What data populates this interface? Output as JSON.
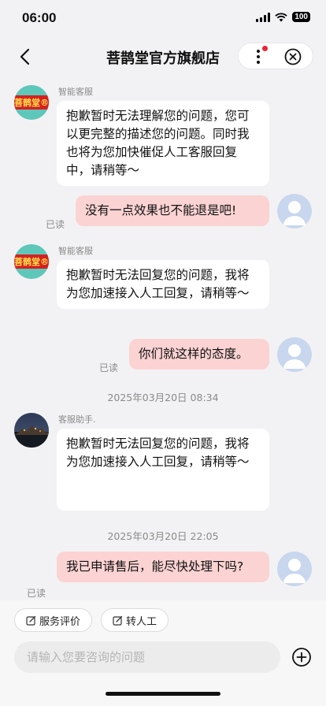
{
  "status_bar": {
    "time": "06:00",
    "battery": "100"
  },
  "nav": {
    "title": "菩鹊堂官方旗舰店"
  },
  "store": {
    "logo_text": "菩鹊堂®"
  },
  "messages": [
    {
      "sender": "智能客服",
      "text": "抱歉暂时无法理解您的问题，您可以更完整的描述您的问题。同时我也将为您加快催促人工客服回复中，请稍等～"
    },
    {
      "text": "没有一点效果也不能退是吧!",
      "read": "已读"
    },
    {
      "sender": "智能客服",
      "text": "抱歉暂时无法回复您的问题，我将为您加速接入人工回复，请稍等～"
    },
    {
      "text": "你们就这样的态度。",
      "read": "已读"
    },
    {
      "timestamp": "2025年03月20日 08:34"
    },
    {
      "sender": "客服助手.",
      "text": "抱歉暂时无法回复您的问题，我将为您加速接入人工回复，请稍等～"
    },
    {
      "timestamp": "2025年03月20日 22:05"
    },
    {
      "text": "我已申请售后，能尽快处理下吗?",
      "read": "已读"
    }
  ],
  "quick_actions": [
    "服务评价",
    "转人工"
  ],
  "input": {
    "placeholder": "请输入您要咨询的问题",
    "value": ""
  },
  "colors": {
    "user_bubble": "#fbd3d3",
    "agent_bubble": "#ffffff",
    "background": "#f2f2f4",
    "notify_dot": "#ee2233"
  },
  "icons": [
    "back-icon",
    "more-icon",
    "close-icon",
    "edit-icon",
    "plus-icon",
    "wifi-icon",
    "signal-icon"
  ]
}
